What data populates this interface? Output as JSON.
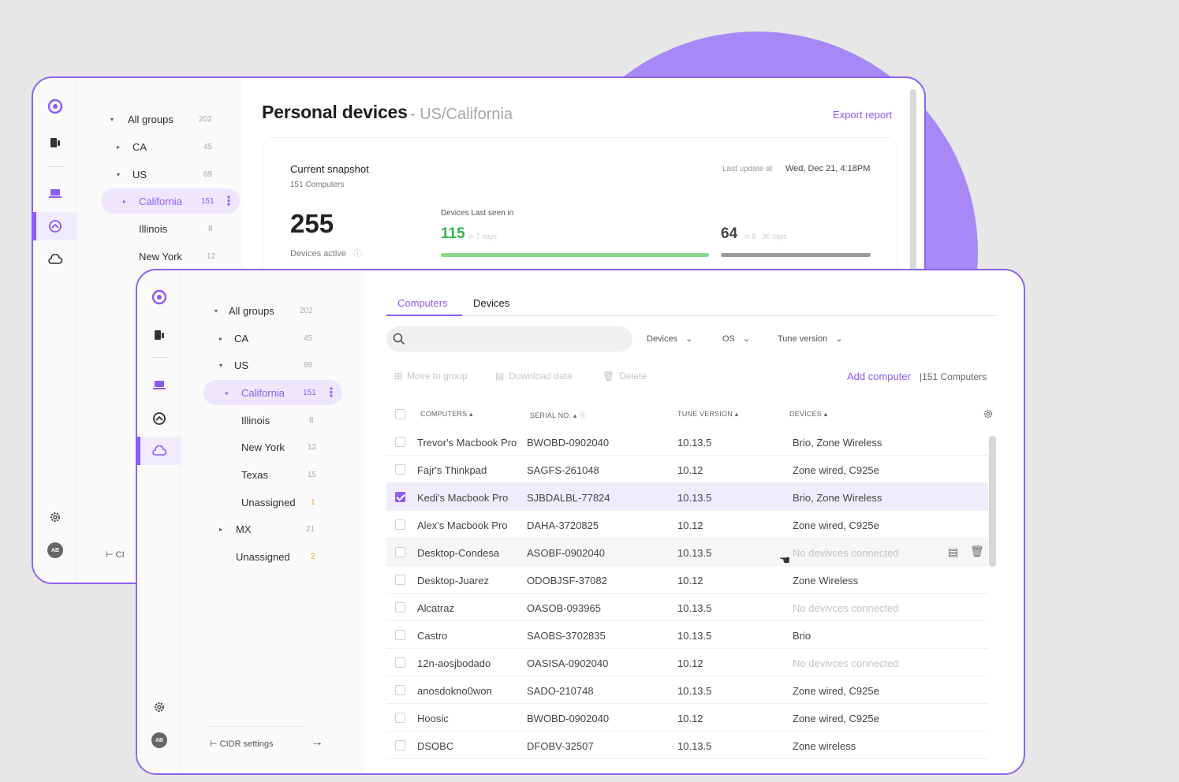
{
  "colors": {
    "accent": "#8b5cf6",
    "accent_light": "#ede6fd",
    "orange_count": "#f5a623",
    "green": "#34b84a",
    "background_blob": "#a688f6"
  },
  "back": {
    "title": "Personal devices",
    "subtitle": "- US/California",
    "export": "Export report",
    "snapshot": {
      "title": "Current snapshot",
      "computers": "151 Computers",
      "last_update_label": "Last update at",
      "last_update_value": "Wed, Dec 21, 4:18PM",
      "active_count": "255",
      "active_label": "Devices active",
      "last_seen_label": "Devices Last seen in",
      "recent_count": "115",
      "recent_label": "in 7 days",
      "recent_progress": 1,
      "older_count": "64",
      "older_label": "in 8 - 30 days",
      "older_progress": 1
    },
    "groups": [
      {
        "name": "All groups",
        "count": "202",
        "arrow": "▾"
      },
      {
        "name": "CA",
        "count": "45",
        "arrow": "▸"
      },
      {
        "name": "US",
        "count": "89",
        "arrow": "▾"
      },
      {
        "name": "California",
        "count": "151",
        "arrow": "▸"
      },
      {
        "name": "Illinois",
        "count": "8",
        "arrow": ""
      },
      {
        "name": "New York",
        "count": "12",
        "arrow": ""
      }
    ],
    "cidr_partial": "CI"
  },
  "front": {
    "tabs": [
      "Computers",
      "Devices"
    ],
    "search_placeholder": "",
    "filters": [
      "Devices",
      "OS",
      "Tune version"
    ],
    "actions": [
      "Move to group",
      "Download data",
      "Delete"
    ],
    "add_computer": "Add computer",
    "computers_count": "|151 Computers",
    "columns": [
      "Computers",
      "Serial no.",
      "Tune version",
      "Devices"
    ],
    "groups": [
      {
        "name": "All groups",
        "count": "202",
        "arrow": "▾"
      },
      {
        "name": "CA",
        "count": "45",
        "arrow": "▸"
      },
      {
        "name": "US",
        "count": "89",
        "arrow": "▾"
      },
      {
        "name": "California",
        "count": "151",
        "arrow": "▸"
      },
      {
        "name": "Illinois",
        "count": "8",
        "arrow": ""
      },
      {
        "name": "New York",
        "count": "12",
        "arrow": ""
      },
      {
        "name": "Texas",
        "count": "15",
        "arrow": ""
      },
      {
        "name": "Unassigned",
        "count": "1",
        "arrow": ""
      },
      {
        "name": "MX",
        "count": "21",
        "arrow": "▸"
      },
      {
        "name": "Unassigned",
        "count": "2",
        "arrow": ""
      }
    ],
    "cidr": "CIDR settings",
    "rows": [
      {
        "name": "Trevor's Macbook Pro",
        "serial": "BWOBD-0902040",
        "tune": "10.13.5",
        "devices": "Brio, Zone Wireless"
      },
      {
        "name": "Fajr's Thinkpad",
        "serial": "SAGFS-261048",
        "tune": "10.12",
        "devices": "Zone wired, C925e"
      },
      {
        "name": "Kedi's Macbook Pro",
        "serial": "SJBDALBL-77824",
        "tune": "10.13.5",
        "devices": "Brio, Zone Wireless"
      },
      {
        "name": "Alex's Macbook Pro",
        "serial": "DAHA-3720825",
        "tune": "10.12",
        "devices": "Zone wired, C925e"
      },
      {
        "name": "Desktop-Condesa",
        "serial": "ASOBF-0902040",
        "tune": "10.13.5",
        "devices": "No devivces connected"
      },
      {
        "name": "Desktop-Juarez",
        "serial": "ODOBJSF-37082",
        "tune": "10.12",
        "devices": "Zone Wireless"
      },
      {
        "name": "Alcatraz",
        "serial": "OASOB-093965",
        "tune": "10.13.5",
        "devices": "No devivces connected"
      },
      {
        "name": "Castro",
        "serial": "SAOBS-3702835",
        "tune": "10.13.5",
        "devices": "Brio"
      },
      {
        "name": "12n-aosjbodado",
        "serial": "OASISA-0902040",
        "tune": "10.12",
        "devices": "No devivces connected"
      },
      {
        "name": "anosdokno0won",
        "serial": "SADO-210748",
        "tune": "10.13.5",
        "devices": "Zone wired, C925e"
      },
      {
        "name": "Hoosic",
        "serial": "BWOBD-0902040",
        "tune": "10.12",
        "devices": "Zone wired, C925e"
      },
      {
        "name": "DSOBC",
        "serial": "DFOBV-32507",
        "tune": "10.13.5",
        "devices": "Zone wireless"
      }
    ],
    "avatar": "AB"
  }
}
